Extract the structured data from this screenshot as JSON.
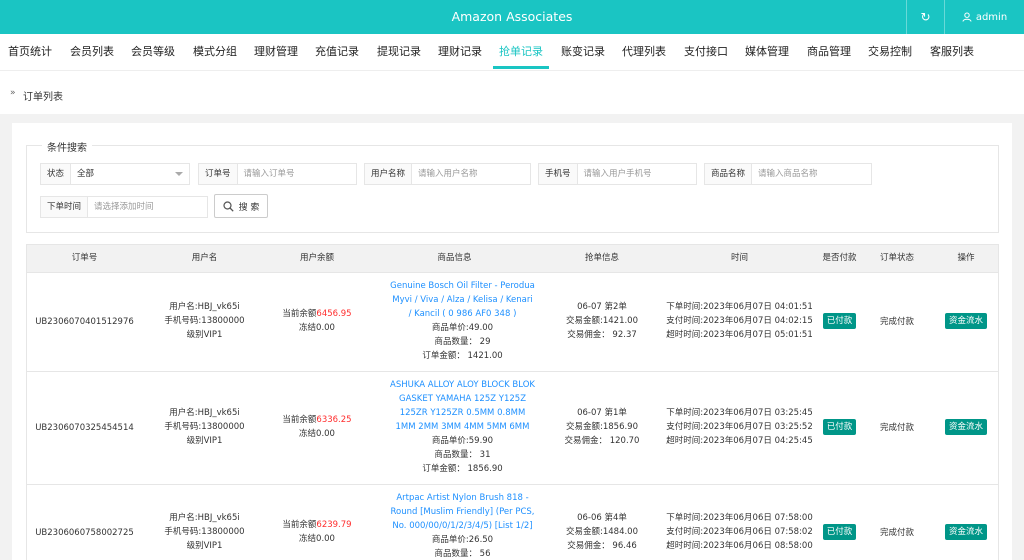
{
  "header": {
    "title": "Amazon Associates",
    "refresh_icon": "↻",
    "user_icon": "user-icon",
    "user": "admin"
  },
  "nav": {
    "items": [
      "首页统计",
      "会员列表",
      "会员等级",
      "模式分组",
      "理财管理",
      "充值记录",
      "提现记录",
      "理财记录",
      "抢单记录",
      "账变记录",
      "代理列表",
      "支付接口",
      "媒体管理",
      "商品管理",
      "交易控制",
      "客服列表"
    ],
    "active": "抢单记录"
  },
  "breadcrumb": {
    "arrow": "»",
    "text": "订单列表"
  },
  "search": {
    "legend": "条件搜索",
    "status_label": "状态",
    "status_value": "全部",
    "order_label": "订单号",
    "order_placeholder": "请输入订单号",
    "username_label": "用户名称",
    "username_placeholder": "请输入用户名称",
    "phone_label": "手机号",
    "phone_placeholder": "请输入用户手机号",
    "product_label": "商品名称",
    "product_placeholder": "请输入商品名称",
    "time_label": "下单时间",
    "time_placeholder": "请选择添加时间",
    "search_button": "搜 索"
  },
  "table": {
    "headers": [
      "订单号",
      "用户名",
      "用户余额",
      "商品信息",
      "抢单信息",
      "时间",
      "是否付款",
      "订单状态",
      "操作"
    ],
    "rows": [
      {
        "order_no": "UB2306070401512976",
        "user_name": "用户名:HBJ_vk65i",
        "user_phone": "手机号码:13800000",
        "user_level": "级别VIP1",
        "balance_label": "当前余额",
        "balance": "6456.95",
        "frozen": "冻结0.00",
        "product_title": "Genuine Bosch Oil Filter - Perodua Myvi / Viva / Alza / Kelisa / Kenari / Kancil ( 0 986 AF0 348 )",
        "unit_price": "商品单价:49.00",
        "quantity": "商品数量： 29",
        "order_amount": "订单金额： 1421.00",
        "grab_date": "06-07 第2单",
        "trade_amount": "交易金额:1421.00",
        "commission": "交易佣金： 92.37",
        "order_time": "下单时间:2023年06月07日 04:01:51",
        "pay_time": "支付时间:2023年06月07日 04:02:15",
        "timeout_time": "超时时间:2023年06月07日 05:01:51",
        "paid": "已付款",
        "status": "完成付款",
        "action": "资金流水"
      },
      {
        "order_no": "UB2306070325454514",
        "user_name": "用户名:HBJ_vk65i",
        "user_phone": "手机号码:13800000",
        "user_level": "级别VIP1",
        "balance_label": "当前余额",
        "balance": "6336.25",
        "frozen": "冻结0.00",
        "product_title": "ASHUKA ALLOY ALOY BLOCK BLOK GASKET YAMAHA 125Z Y125Z 125ZR Y125ZR 0.5MM 0.8MM 1MM 2MM 3MM 4MM 5MM 6MM",
        "unit_price": "商品单价:59.90",
        "quantity": "商品数量： 31",
        "order_amount": "订单金额： 1856.90",
        "grab_date": "06-07 第1单",
        "trade_amount": "交易金额:1856.90",
        "commission": "交易佣金： 120.70",
        "order_time": "下单时间:2023年06月07日 03:25:45",
        "pay_time": "支付时间:2023年06月07日 03:25:52",
        "timeout_time": "超时时间:2023年06月07日 04:25:45",
        "paid": "已付款",
        "status": "完成付款",
        "action": "资金流水"
      },
      {
        "order_no": "UB2306060758002725",
        "user_name": "用户名:HBJ_vk65i",
        "user_phone": "手机号码:13800000",
        "user_level": "级别VIP1",
        "balance_label": "当前余额",
        "balance": "6239.79",
        "frozen": "冻结0.00",
        "product_title": "Artpac Artist Nylon Brush 818 - Round [Muslim Friendly] (Per PCS, No. 000/00/0/1/2/3/4/5) [List 1/2]",
        "unit_price": "商品单价:26.50",
        "quantity": "商品数量： 56",
        "order_amount": "",
        "grab_date": "06-06 第4单",
        "trade_amount": "交易金额:1484.00",
        "commission": "交易佣金： 96.46",
        "order_time": "下单时间:2023年06月06日 07:58:00",
        "pay_time": "支付时间:2023年06月06日 07:58:02",
        "timeout_time": "超时时间:2023年06月06日 08:58:00",
        "paid": "已付款",
        "status": "完成付款",
        "action": "资金流水"
      }
    ]
  }
}
